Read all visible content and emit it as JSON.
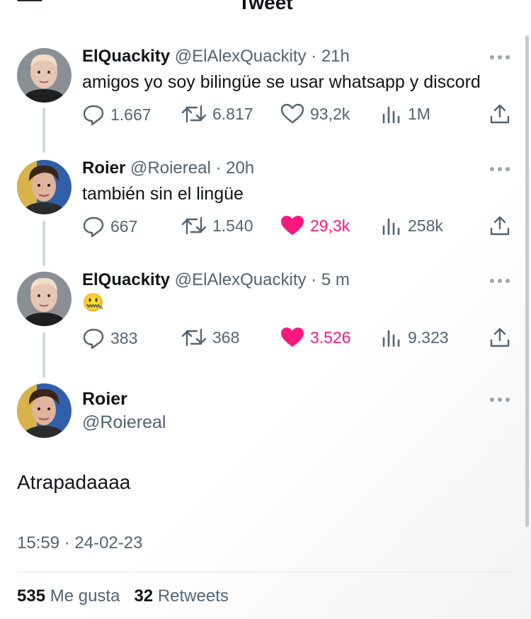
{
  "header": {
    "title": "Tweet"
  },
  "thread": [
    {
      "name": "ElQuackity",
      "handle": "@ElAlexQuackity",
      "time": "21h",
      "text": "amigos yo soy bilingüe se usar whatsapp y discord",
      "replies": "1.667",
      "retweets": "6.817",
      "likes": "93,2k",
      "views": "1M",
      "liked": false
    },
    {
      "name": "Roier",
      "handle": "@Roiereal",
      "time": "20h",
      "text": "también sin el lingüe",
      "replies": "667",
      "retweets": "1.540",
      "likes": "29,3k",
      "views": "258k",
      "liked": true
    },
    {
      "name": "ElQuackity",
      "handle": "@ElAlexQuackity",
      "time": "5 m",
      "text": "🤐",
      "replies": "383",
      "retweets": "368",
      "likes": "3.526",
      "views": "9.323",
      "liked": true
    }
  ],
  "focus": {
    "name": "Roier",
    "handle": "@Roiereal",
    "text": "Atrapadaaaa",
    "timestamp": "15:59 · 24-02-23",
    "likes_count": "535",
    "likes_label": "Me gusta",
    "retweets_count": "32",
    "retweets_label": "Retweets"
  },
  "icons": {
    "reply": "reply-icon",
    "retweet": "retweet-icon",
    "like": "heart-icon",
    "views": "views-icon",
    "share": "share-icon",
    "more": "more-icon",
    "back": "back-arrow-icon"
  },
  "colors": {
    "text": "#0f1419",
    "secondary": "#536471",
    "like": "#f91880",
    "thread_line": "#cfd9de"
  }
}
